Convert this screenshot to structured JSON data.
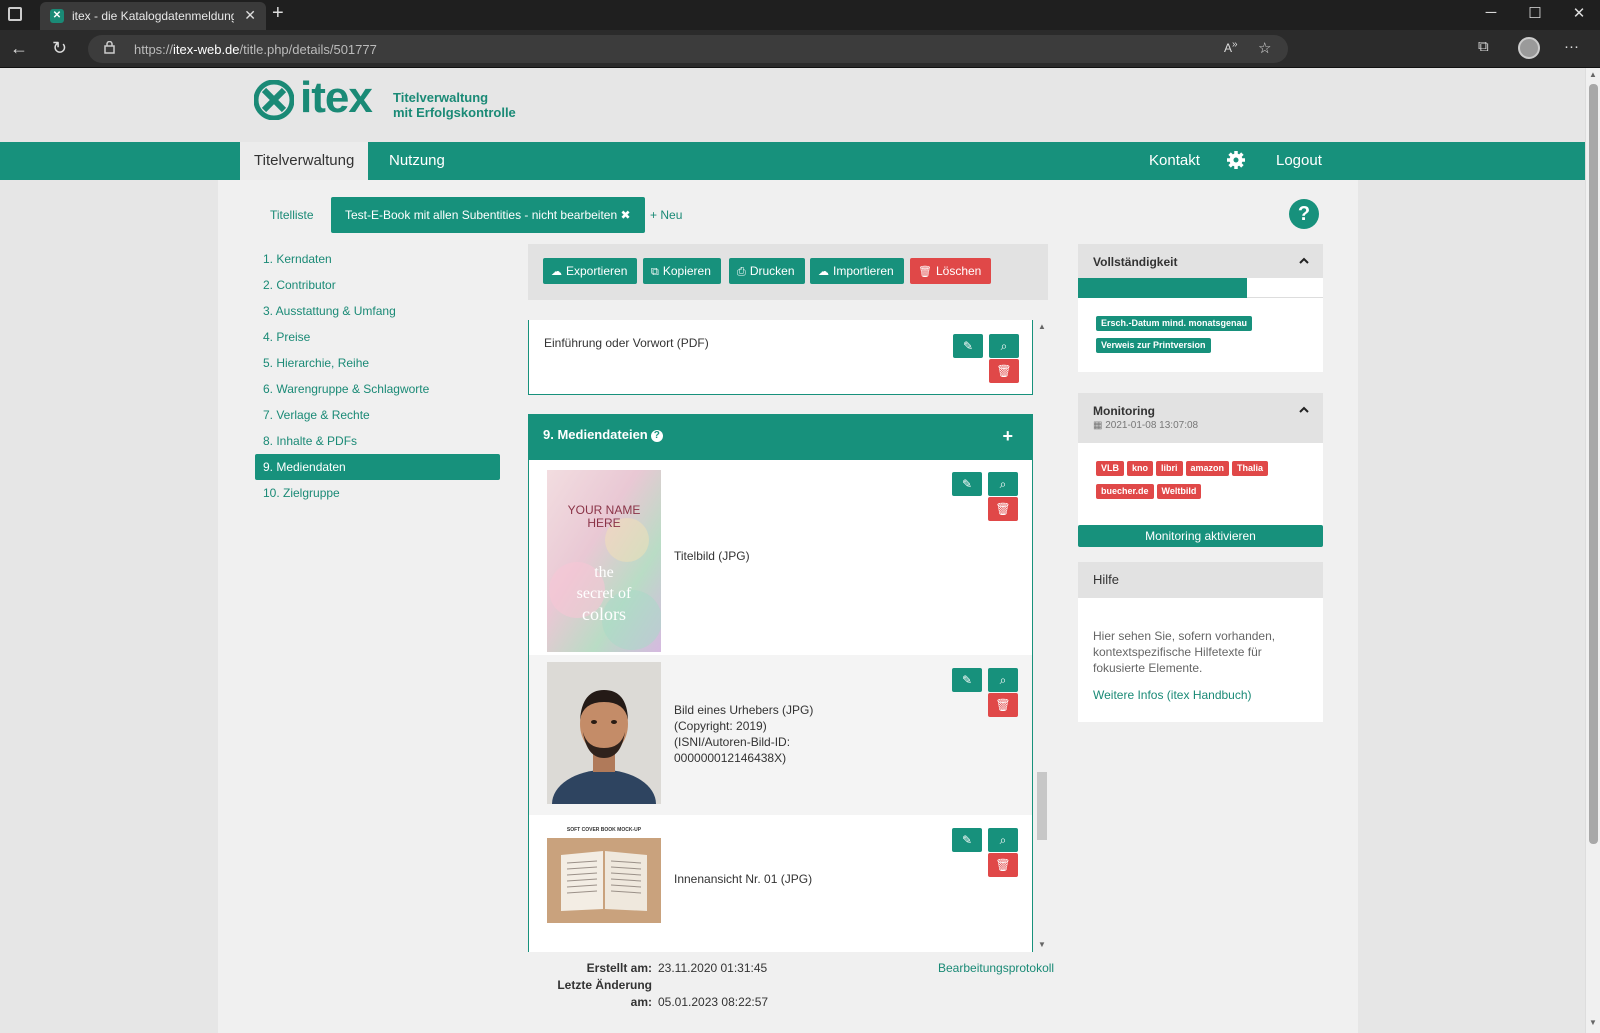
{
  "browser": {
    "tab_title": "itex - die Katalogdatenmeldung",
    "url_prefix": "https://",
    "url_host": "itex-web.de",
    "url_path": "/title.php/details/501777"
  },
  "header": {
    "logo_word": "itex",
    "logo_sub_line1": "Titelverwaltung",
    "logo_sub_line2": "mit Erfolgskontrolle"
  },
  "mainnav": {
    "items": [
      {
        "label": "Titelverwaltung"
      },
      {
        "label": "Nutzung"
      }
    ],
    "kontakt": "Kontakt",
    "logout": "Logout"
  },
  "subtabs": {
    "titelliste": "Titelliste",
    "active": "Test-E-Book mit allen Subentities - nicht bearbeiten",
    "neu": "Neu"
  },
  "leftmenu": [
    {
      "label": "1. Kerndaten"
    },
    {
      "label": "2. Contributor"
    },
    {
      "label": "3. Ausstattung & Umfang"
    },
    {
      "label": "4. Preise"
    },
    {
      "label": "5. Hierarchie, Reihe"
    },
    {
      "label": "6. Warengruppe & Schlagworte"
    },
    {
      "label": "7. Verlage & Rechte"
    },
    {
      "label": "8. Inhalte & PDFs"
    },
    {
      "label": "9. Mediendaten"
    },
    {
      "label": "10. Zielgruppe"
    }
  ],
  "toolbar": {
    "export": "Exportieren",
    "copy": "Kopieren",
    "print": "Drucken",
    "import": "Importieren",
    "delete": "Löschen"
  },
  "pdf_item": {
    "label": "Einführung oder Vorwort (PDF)"
  },
  "media": {
    "title": "9. Mediendateien",
    "items": [
      {
        "line1": "Titelbild  (JPG)"
      },
      {
        "line1": "Bild eines Urhebers  (JPG)",
        "line2": "(Copyright: 2019)",
        "line3": "(ISNI/Autoren-Bild-ID:",
        "line4": "000000012146438X)"
      },
      {
        "line1": "Innenansicht  Nr. 01  (JPG)"
      }
    ],
    "cover": {
      "line1": "YOUR NAME",
      "line2": "HERE",
      "title1": "the",
      "title2": "secret of",
      "title3": "colors"
    },
    "mockup_caption": "SOFT COVER BOOK MOCK-UP"
  },
  "footer": {
    "created_label": "Erstellt am:",
    "created_value": "23.11.2020 01:31:45",
    "changed_label": "Letzte Änderung am:",
    "changed_value": "05.01.2023 08:22:57",
    "protocol_link": "Bearbeitungsprotokoll"
  },
  "completeness": {
    "title": "Vollständigkeit",
    "progress_fraction": 0.69,
    "badges": [
      "Ersch.-Datum mind. monatsgenau",
      "Verweis zur Printversion"
    ]
  },
  "monitoring": {
    "title": "Monitoring",
    "date": "2021-01-08 13:07:08",
    "shops": [
      "VLB",
      "kno",
      "libri",
      "amazon",
      "Thalia",
      "buecher.de",
      "Weltbild"
    ],
    "button": "Monitoring aktivieren"
  },
  "help": {
    "title": "Hilfe",
    "text": "Hier sehen Sie, sofern vorhanden, kontextspezifische Hilfetexte für fokusierte Elemente.",
    "link": "Weitere Infos (itex Handbuch)"
  },
  "colors": {
    "primary": "#17917c",
    "danger": "#e04848"
  }
}
